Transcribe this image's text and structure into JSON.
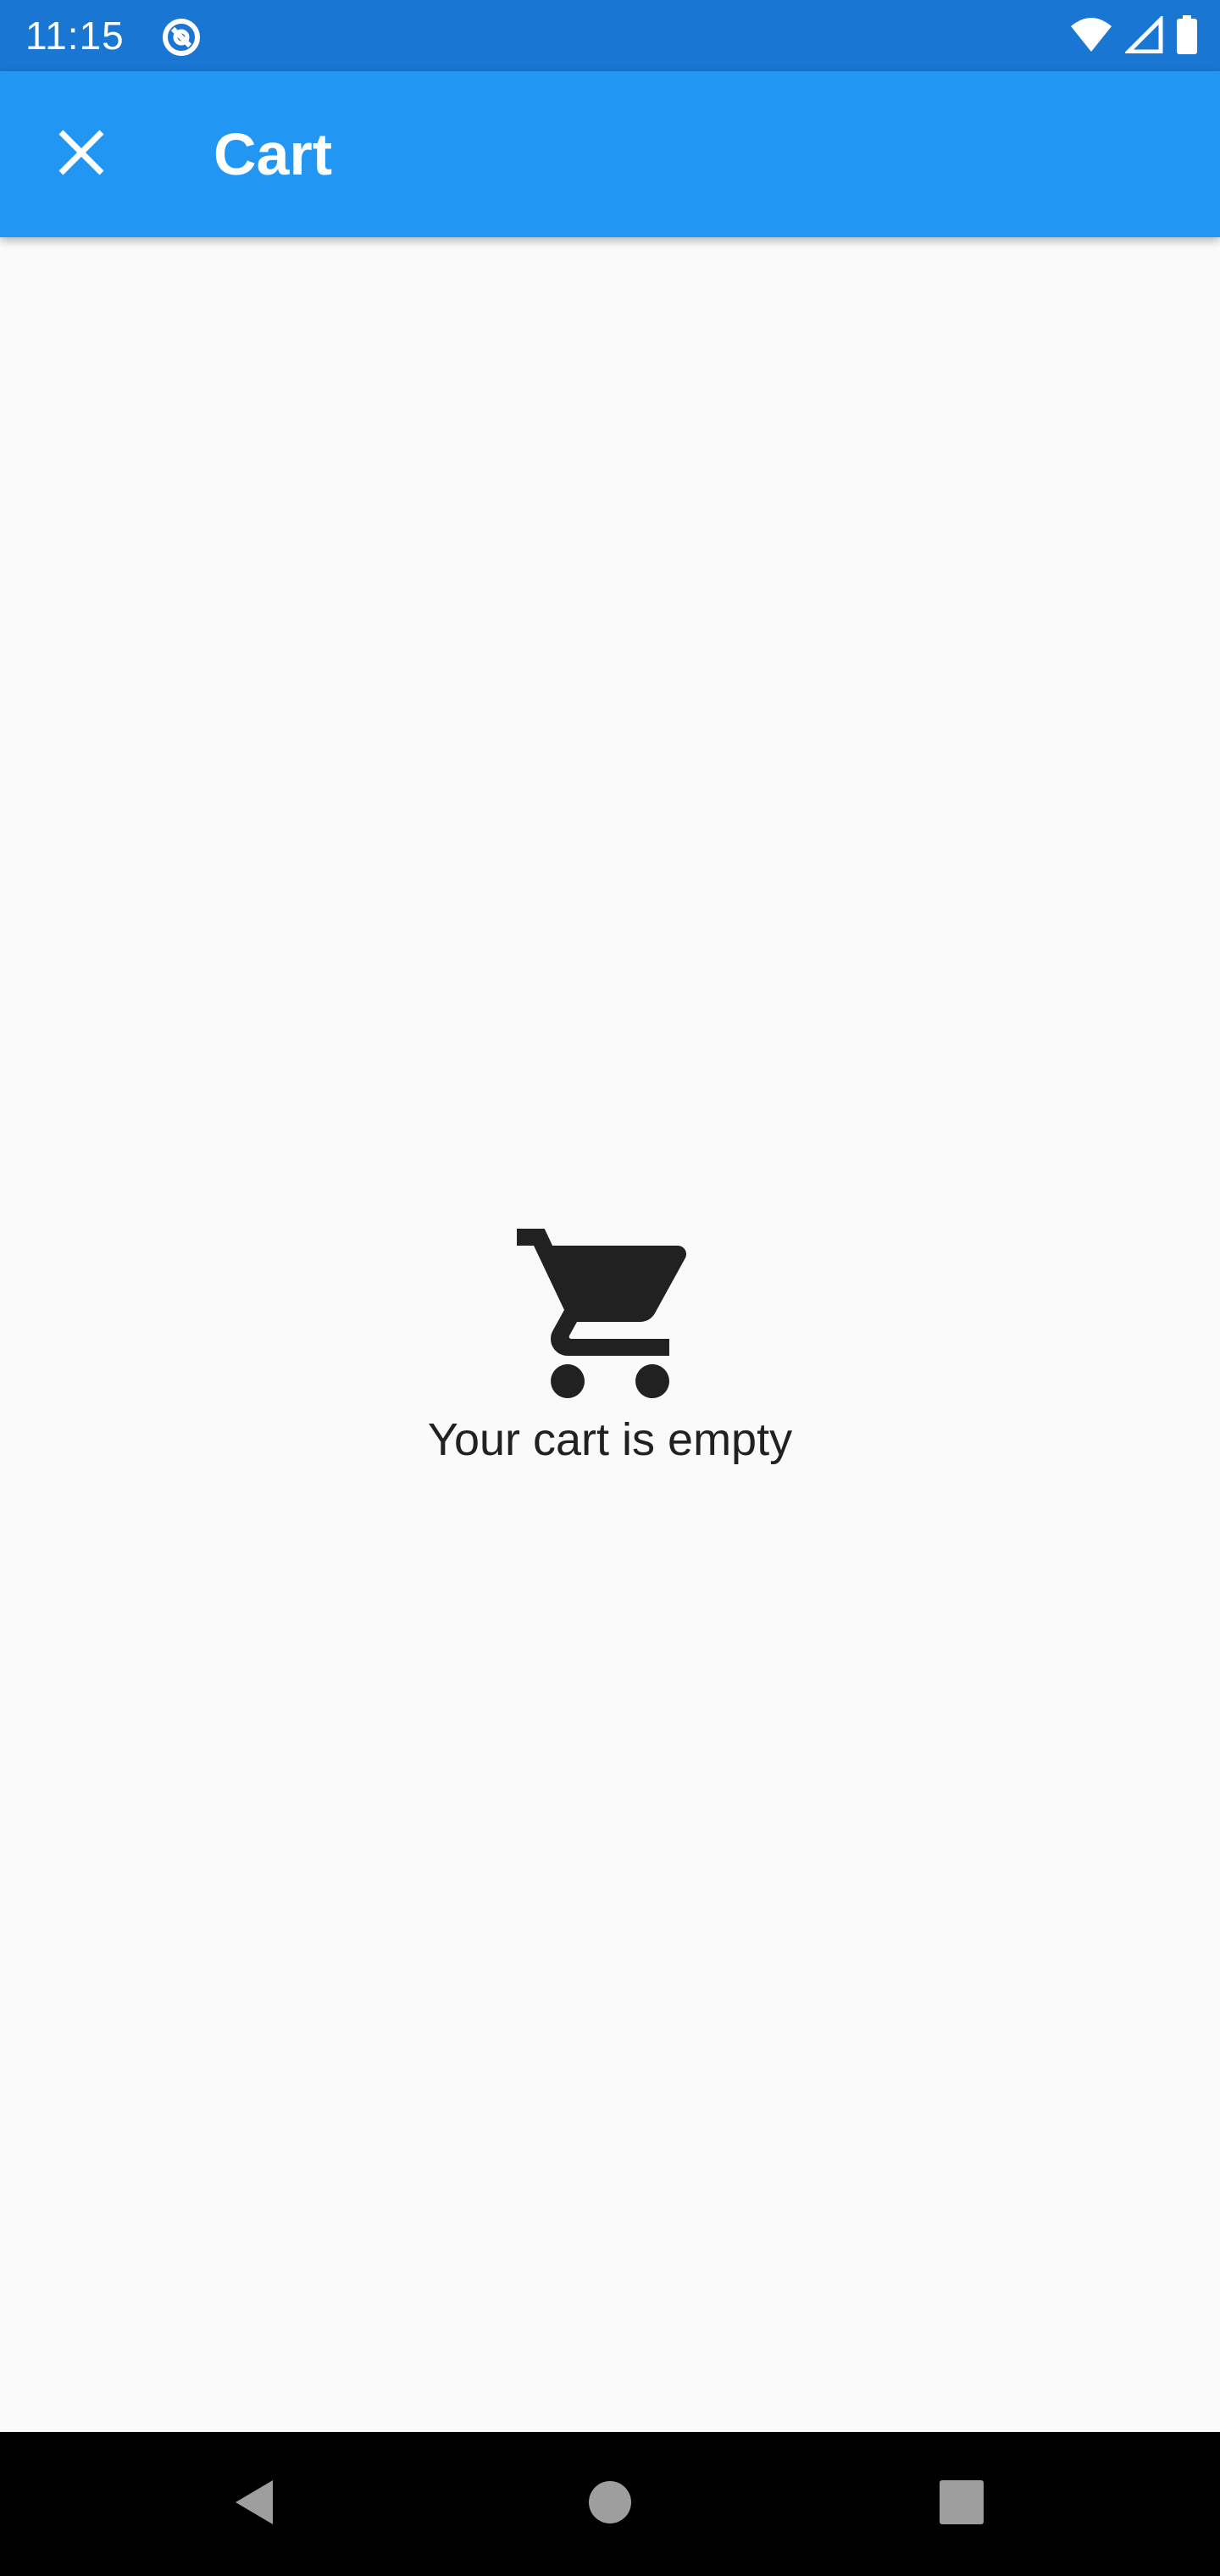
{
  "status_bar": {
    "time": "11:15",
    "icons": [
      "app-notification-icon",
      "wifi-icon",
      "cellular-signal-icon",
      "battery-icon"
    ]
  },
  "app_bar": {
    "close_icon": "close-icon",
    "title": "Cart",
    "color": "#2196f3"
  },
  "content": {
    "empty_icon": "shopping-cart-icon",
    "empty_message": "Your cart is empty"
  },
  "nav_bar": {
    "buttons": [
      "back-icon",
      "home-icon",
      "recents-icon"
    ]
  },
  "colors": {
    "status_bar": "#1976d2",
    "app_bar": "#2196f3",
    "background": "#fafafa",
    "text": "#212121"
  }
}
